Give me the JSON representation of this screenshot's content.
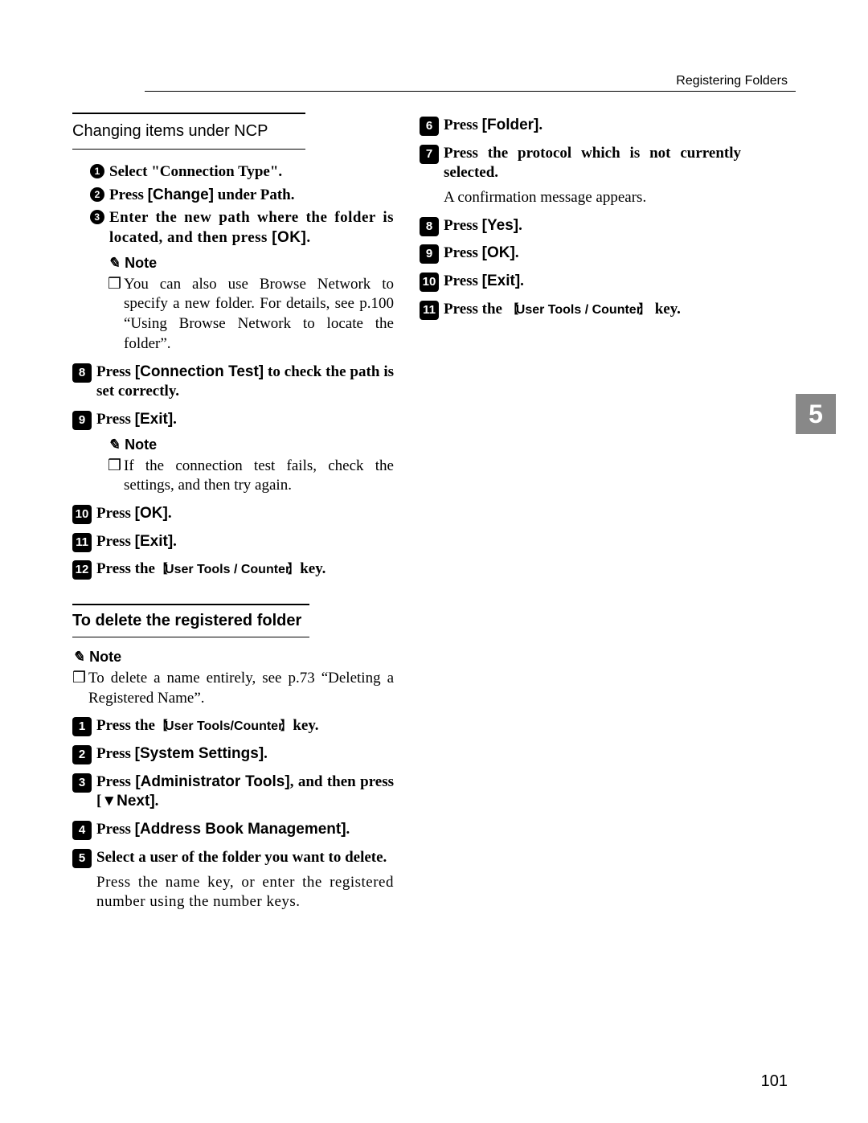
{
  "header": "Registering Folders",
  "page_number": "101",
  "tab": "5",
  "left": {
    "box_title": "Changing items under NCP",
    "sub": {
      "a": {
        "pre": "Select \"Connection Type\"."
      },
      "b": {
        "pre": "Press ",
        "btn": "[Change]",
        "post": " under Path."
      },
      "c": {
        "pre": "Enter the new path where the folder is located, and then press ",
        "btn": "[OK]",
        "post": "."
      }
    },
    "note1_label": "Note",
    "note1_text": "You can also use Browse Network to specify a new folder. For details, see p.100 “Using Browse Network to locate the folder”.",
    "s8": {
      "pre": "Press ",
      "btn": "[Connection Test]",
      "post": " to check the path is set correctly."
    },
    "s9": {
      "pre": "Press ",
      "btn": "[Exit]",
      "post": "."
    },
    "note2_label": "Note",
    "note2_text": "If the connection test fails, check the settings, and then try again.",
    "s10": {
      "pre": "Press ",
      "btn": "[OK]",
      "post": "."
    },
    "s11": {
      "pre": "Press ",
      "btn": "[Exit]",
      "post": "."
    },
    "s12": {
      "pre": "Press the",
      "key": "User Tools / Counter",
      "post": "key."
    },
    "section_title": "To delete the registered folder",
    "note3_label": "Note",
    "note3_text": "To delete a name entirely, see p.73 “Deleting a Registered Name”.",
    "d1": {
      "pre": "Press the",
      "key": "User Tools/Counter",
      "post": "key."
    },
    "d2": {
      "pre": "Press ",
      "btn": "[System Settings]",
      "post": "."
    },
    "d3": {
      "pre": "Press ",
      "btn": "[Administrator Tools]",
      "post": ", and then press [",
      "arrow": "▼",
      "btn2": "Next]",
      "post2": "."
    },
    "d4": {
      "pre": "Press ",
      "btn": "[Address Book Management]",
      "post": "."
    },
    "d5": {
      "pre": "Select a user of the folder you want to delete."
    },
    "d5_body": "Press the name key, or enter the registered number using the number keys."
  },
  "right": {
    "s6": {
      "pre": "Press ",
      "btn": "[Folder]",
      "post": "."
    },
    "s7": {
      "pre": "Press the protocol which is not currently selected."
    },
    "s7_body": "A confirmation message appears.",
    "s8": {
      "pre": "Press ",
      "btn": "[Yes]",
      "post": "."
    },
    "s9": {
      "pre": "Press ",
      "btn": "[OK]",
      "post": "."
    },
    "s10": {
      "pre": "Press ",
      "btn": "[Exit]",
      "post": "."
    },
    "s11": {
      "pre": "Press the ",
      "key": "User Tools / Counter",
      "post": " key."
    }
  }
}
